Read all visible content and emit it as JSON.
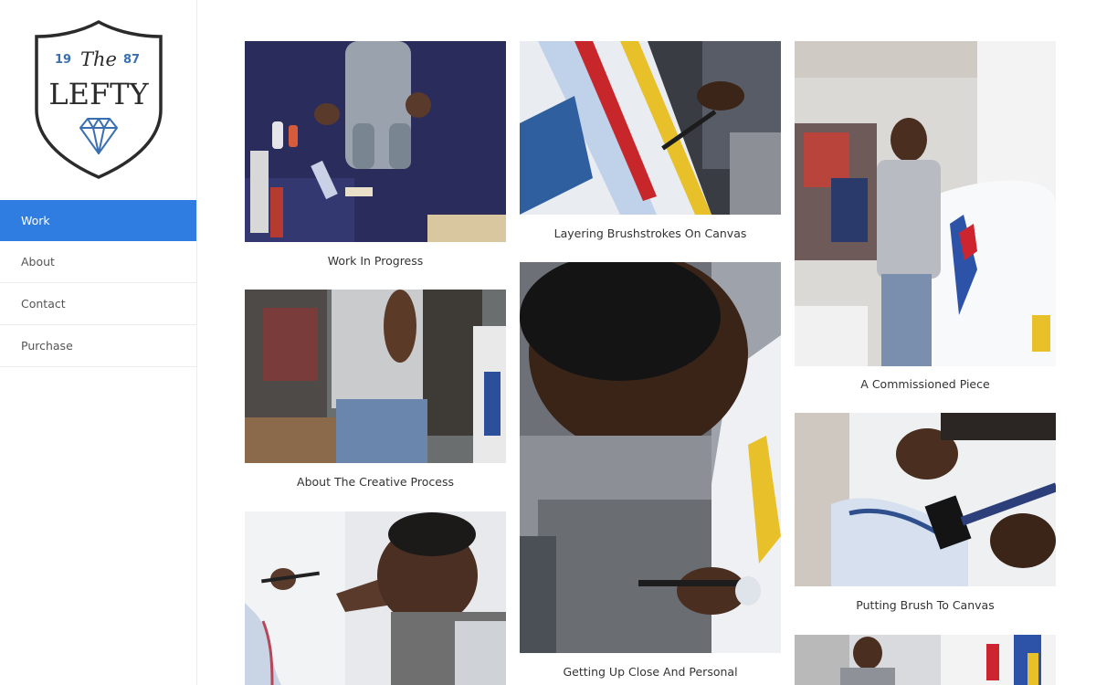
{
  "logo": {
    "line1": "The",
    "line2": "LEFTY",
    "year_left": "19",
    "year_right": "87",
    "accent": "#3a6fb0"
  },
  "nav": {
    "items": [
      {
        "label": "Work",
        "active": true
      },
      {
        "label": "About",
        "active": false
      },
      {
        "label": "Contact",
        "active": false
      },
      {
        "label": "Purchase",
        "active": false
      }
    ],
    "active_color": "#2f7de1"
  },
  "gallery": {
    "items": [
      {
        "caption": "Work In Progress"
      },
      {
        "caption": "Layering Brushstrokes On Canvas"
      },
      {
        "caption": "A Commissioned Piece"
      },
      {
        "caption": "About The Creative Process"
      },
      {
        "caption": "Getting Up Close And Personal"
      },
      {
        "caption": "Putting Brush To Canvas"
      },
      {
        "caption": ""
      },
      {
        "caption": ""
      }
    ]
  }
}
